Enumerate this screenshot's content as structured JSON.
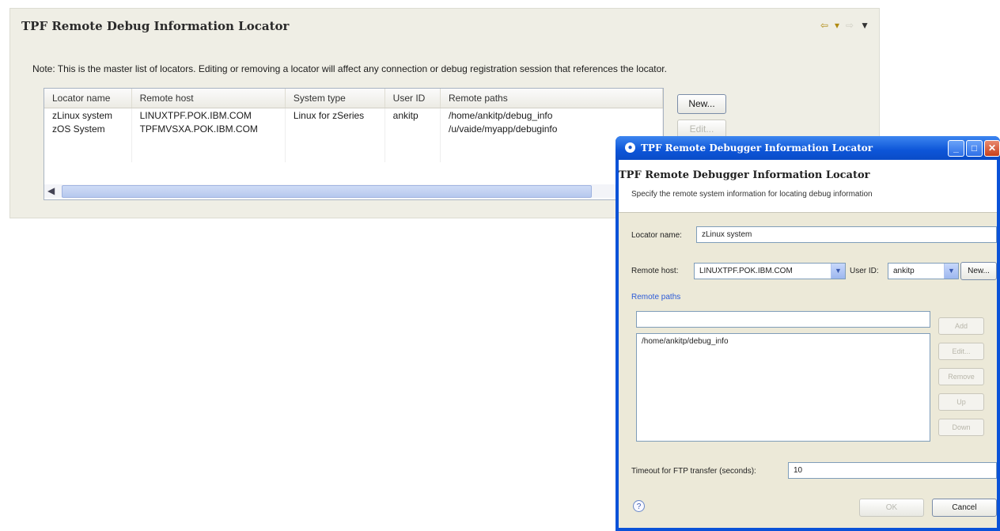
{
  "page": {
    "title": "TPF Remote Debug Information Locator",
    "note": "Note: This is the master list of locators. Editing or removing a locator will affect any connection or debug registration session that references the locator.",
    "nav": {
      "back_icon": "⇦",
      "dropdown_icon": "▾",
      "forward_icon": "⇨",
      "menu_icon": "▼"
    },
    "table": {
      "columns": [
        "Locator name",
        "Remote host",
        "System type",
        "User ID",
        "Remote paths"
      ],
      "rows": [
        {
          "name": "zLinux system",
          "host": "LINUXTPF.POK.IBM.COM",
          "type": "Linux for zSeries",
          "user": "ankitp",
          "paths": "/home/ankitp/debug_info"
        },
        {
          "name": "zOS System",
          "host": "TPFMVSXA.POK.IBM.COM",
          "type": "",
          "user": "",
          "paths": "/u/vaide/myapp/debuginfo"
        }
      ]
    },
    "buttons": {
      "new": "New...",
      "edit": "Edit..."
    }
  },
  "dialog": {
    "title": "TPF Remote Debugger Information Locator",
    "heading": "TPF Remote Debugger Information Locator",
    "subtitle": "Specify the remote system information for locating debug information",
    "locator_name_label": "Locator name:",
    "locator_name_value": "zLinux system",
    "remote_host_label": "Remote host:",
    "remote_host_value": "LINUXTPF.POK.IBM.COM",
    "user_id_label": "User ID:",
    "user_id_value": "ankitp",
    "new_button": "New...",
    "remote_paths_label": "Remote paths",
    "path_input_value": "",
    "paths": [
      "/home/ankitp/debug_info"
    ],
    "side_buttons": {
      "add": "Add",
      "edit": "Edit...",
      "remove": "Remove",
      "up": "Up",
      "down": "Down"
    },
    "timeout_label": "Timeout for FTP transfer (seconds):",
    "timeout_value": "10",
    "ok": "OK",
    "cancel": "Cancel"
  }
}
